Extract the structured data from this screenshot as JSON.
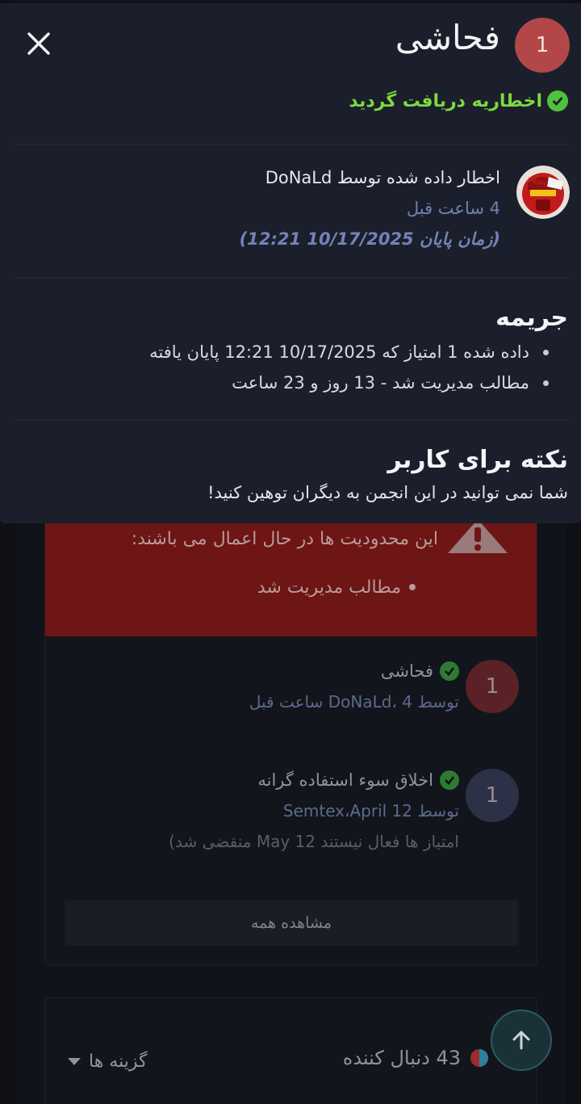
{
  "modal": {
    "points_badge": "1",
    "title": "فحاشی",
    "acknowledged_text": "اخطاریه دریافت گردید",
    "issuer_text": "اخطار داده شده توسط DoNaLd",
    "issued_time": "4 ساعت قبل",
    "end_time": "(زمان پایان 10/17/2025 12:21)",
    "avatar_label": "MEDIC",
    "penalty_heading": "جریمه",
    "penalties": [
      "داده شده 1 امتیاز که 10/17/2025 12:21 پایان یافته",
      "مطالب مدیریت شد - 13 روز و 23 ساعت"
    ],
    "note_heading": "نکته برای کاربر",
    "note_text": "شما نمی توانید در این انجمن به دیگران توهین کنید!"
  },
  "background": {
    "alert_text": "این محدودیت ها در حال اعمال می باشند:",
    "alert_bullet": "مطالب مدیریت شد",
    "warnings": [
      {
        "badge": "1",
        "title": "فحاشی",
        "subtitle": "توسط DoNaLd، 4 ساعت قبل",
        "badge_color": "#5a2226"
      },
      {
        "badge": "1",
        "title": "اخلاق سوء استفاده گرانه",
        "subtitle": "توسط Semtex،April 12",
        "note": "امتیاز ها فعال نیستند May 12 منقضی شد)",
        "badge_color": "#2d3148"
      }
    ],
    "view_all": "مشاهده همه",
    "followers": "43 دنبال کننده",
    "options": "گزینه ها"
  },
  "colors": {
    "modal_bg": "#1b1f2b",
    "accent_green": "#7ed93f",
    "badge_red": "#b34747",
    "alert_red": "#6e1515"
  }
}
